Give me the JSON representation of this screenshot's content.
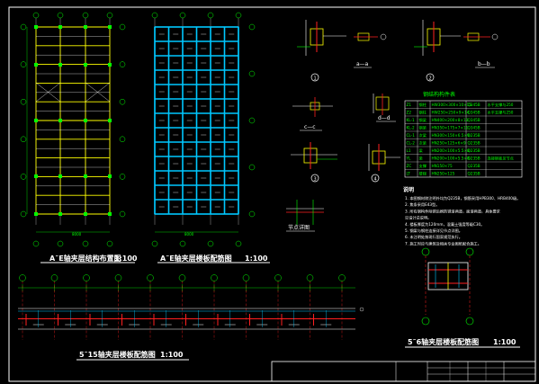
{
  "drawing_titles": {
    "plan_a": "A˜E轴夹层结构布置图",
    "plan_a_scale": "1:100",
    "plan_b": "A˜E轴夹层楼板配筋图",
    "plan_b_scale": "1:100",
    "elevation": "5˜15轴夹层楼板配筋图",
    "elevation_scale": "1:100",
    "small_plan": "5˜6轴夹层楼板配筋图",
    "small_plan_scale": "1:100"
  },
  "section_labels": {
    "a_a": "a—a",
    "b_b": "b—b",
    "c_c": "c—c",
    "d_d": "d—d",
    "node_detail": "节点详图"
  },
  "detail_bubbles": [
    "1",
    "2",
    "3",
    "4"
  ],
  "member_table": {
    "title": "钢结构构件表",
    "rows": [
      [
        "Z1",
        "钢柱",
        "HW300×300×10×15",
        "Q345B",
        "水平支撑与250"
      ],
      [
        "Z2",
        "钢柱",
        "HW250×250×9×14",
        "Q345B",
        "水平支撑与250"
      ],
      [
        "KL-1",
        "钢梁",
        "HN400×200×8×13",
        "Q345B",
        ""
      ],
      [
        "KL-2",
        "钢梁",
        "HN350×175×7×11",
        "Q345B",
        ""
      ],
      [
        "CL-1",
        "次梁",
        "HN300×150×6.5×9",
        "Q235B",
        ""
      ],
      [
        "CL-2",
        "次梁",
        "HN250×125×6×9",
        "Q235B",
        ""
      ],
      [
        "L1",
        "梁",
        "HN200×100×5.5×8",
        "Q235B",
        ""
      ],
      [
        "YL",
        "梁",
        "HN200×100×5.5×8",
        "Q235B",
        "连接钢板见节点"
      ],
      [
        "ZC",
        "支撑",
        "HN150×75",
        "Q235B",
        ""
      ],
      [
        "LT",
        "楼梯",
        "HN250×125",
        "Q235B",
        ""
      ]
    ]
  },
  "notes": {
    "heading": "说明",
    "lines": [
      "1. 本图钢材除注明外均为Q235B，钢筋采用HPB300、HRB400级。",
      "2. 焦条采用E43型。",
      "3. 所有钢构件除锈后刷防锈漆两道，面漆两道，具体要求",
      "   见设计总说明。",
      "4. 楼板厚度为120mm，混凝土强度等级C30。",
      "5. 钢梁与钢柱连接详见节点详图。",
      "6. 未注明处按现行国家规范执行。",
      "7. 施工时应与建筑及相关专业图纸配合施工。"
    ]
  },
  "dimensions": {
    "plan_a_bottom": "8000",
    "plan_b_bottom": "8000"
  },
  "colors": {
    "background": "#000000",
    "frame": "#ffffff",
    "grid_line": "#ffffff",
    "beam": "#ffff00",
    "slab_rebar": "#00c8ff",
    "column": "#00ff00",
    "section_red": "#ff2020",
    "dimension": "#00ff00",
    "axis_bubble": "#00ff00",
    "title_text": "#ffffff",
    "table_line": "#ffffff",
    "table_text": "#00ff00",
    "notes_text": "#ffffff"
  }
}
